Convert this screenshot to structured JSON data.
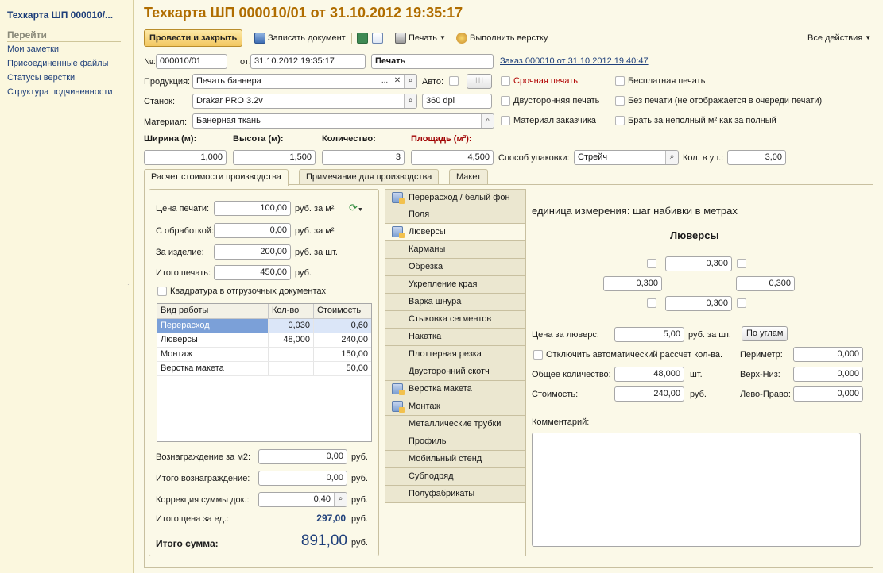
{
  "sidebar": {
    "title": "Техкарта ШП 000010/...",
    "goto_label": "Перейти",
    "links": [
      "Мои заметки",
      "Присоединенные файлы",
      "Статусы верстки",
      "Структура подчиненности"
    ]
  },
  "header": {
    "title": "Техкарта ШП 000010/01 от 31.10.2012 19:35:17"
  },
  "toolbar": {
    "post_close": "Провести и закрыть",
    "save_doc": "Записать документ",
    "print": "Печать",
    "do_layout": "Выполнить верстку",
    "all_actions": "Все действия"
  },
  "fields": {
    "number_label": "№:",
    "number": "000010/01",
    "from_label": "от:",
    "date": "31.10.2012 19:35:17",
    "status": "Печать",
    "order_link": "Заказ 000010 от 31.10.2012 19:40:47",
    "product_label": "Продукция:",
    "product": "Печать баннера",
    "auto_label": "Авто:",
    "machine_label": "Станок:",
    "machine": "Drakar PRO 3.2v",
    "dpi": "360 dpi",
    "material_label": "Материал:",
    "material": "Банерная ткань",
    "width_label": "Ширина (м):",
    "height_label": "Высота (м):",
    "qty_label": "Количество:",
    "area_label": "Площадь (м²):",
    "width": "1,000",
    "height": "1,500",
    "qty": "3",
    "area": "4,500",
    "pack_label": "Способ упаковки:",
    "pack": "Стрейч",
    "per_pack_label": "Кол. в уп.:",
    "per_pack": "3,00"
  },
  "flags": {
    "urgent": "Срочная печать",
    "free": "Бесплатная печать",
    "duplex": "Двусторонняя печать",
    "no_print": "Без печати (не отображается в очереди печати)",
    "customer_material": "Материал заказчика",
    "partial_m2": "Брать за неполный м² как за полный"
  },
  "tabs": [
    "Расчет стоимости производства",
    "Примечание для производства",
    "Макет"
  ],
  "cost": {
    "print_price_label": "Цена печати:",
    "print_price": "100,00",
    "print_price_unit": "руб. за  м²",
    "processing_label": "С обработкой:",
    "processing": "0,00",
    "processing_unit": "руб. за  м²",
    "per_item_label": "За изделие:",
    "per_item": "200,00",
    "per_item_unit": "руб. за  шт.",
    "total_print_label": "Итого печать:",
    "total_print": "450,00",
    "total_print_unit": "руб.",
    "quadrature_label": "Квадратура в отгрузочных документах",
    "works_headers": [
      "Вид работы",
      "Кол-во",
      "Стоимость"
    ],
    "works": [
      {
        "name": "Перерасход",
        "qty": "0,030",
        "cost": "0,60"
      },
      {
        "name": "Люверсы",
        "qty": "48,000",
        "cost": "240,00"
      },
      {
        "name": "Монтаж",
        "qty": "",
        "cost": "150,00"
      },
      {
        "name": "Верстка макета",
        "qty": "",
        "cost": "50,00"
      }
    ],
    "reward_m2_label": "Вознаграждение за м2:",
    "reward_m2": "0,00",
    "total_reward_label": "Итого вознаграждение:",
    "total_reward": "0,00",
    "correction_label": "Коррекция суммы док.:",
    "correction": "0,40",
    "unit_price_label": "Итого цена за ед.:",
    "unit_price": "297,00",
    "total_sum_label": "Итого сумма:",
    "total_sum": "891,00",
    "rub": "руб."
  },
  "services": [
    {
      "label": "Перерасход / белый фон",
      "icon": true
    },
    {
      "label": "Поля",
      "icon": false
    },
    {
      "label": "Люверсы",
      "icon": true,
      "active": true
    },
    {
      "label": "Карманы",
      "icon": false
    },
    {
      "label": "Обрезка",
      "icon": false
    },
    {
      "label": "Укрепление края",
      "icon": false
    },
    {
      "label": "Варка шнура",
      "icon": false
    },
    {
      "label": "Стыковка сегментов",
      "icon": false
    },
    {
      "label": "Накатка",
      "icon": false
    },
    {
      "label": "Плоттерная резка",
      "icon": false
    },
    {
      "label": "Двусторонний скотч",
      "icon": false
    },
    {
      "label": "Верстка макета",
      "icon": true
    },
    {
      "label": "Монтаж",
      "icon": true
    },
    {
      "label": "Металлические трубки",
      "icon": false
    },
    {
      "label": "Профиль",
      "icon": false
    },
    {
      "label": "Мобильный стенд",
      "icon": false
    },
    {
      "label": "Субподряд",
      "icon": false
    },
    {
      "label": "Полуфабрикаты",
      "icon": false
    }
  ],
  "grommets": {
    "unit_note": "единица измерения: шаг набивки в метрах",
    "heading": "Люверсы",
    "top": "0,300",
    "left": "0,300",
    "right": "0,300",
    "bottom": "0,300",
    "price_label": "Цена за люверс:",
    "price": "5,00",
    "price_unit": "руб. за шт.",
    "corners_btn": "По углам",
    "auto_off_label": "Отключить автоматический рассчет кол-ва.",
    "perimeter_label": "Периметр:",
    "perimeter": "0,000",
    "total_qty_label": "Общее количество:",
    "total_qty": "48,000",
    "total_qty_unit": "шт.",
    "top_bottom_label": "Верх-Низ:",
    "top_bottom": "0,000",
    "cost_label": "Стоимость:",
    "cost": "240,00",
    "cost_unit": "руб.",
    "left_right_label": "Лево-Право:",
    "left_right": "0,000",
    "comment_label": "Комментарий:"
  },
  "colors": {
    "title": "#b06d00",
    "link": "#1e3f7a",
    "urgent": "#b00000",
    "area_label": "#a00000",
    "total_blue": "#1e3f7a"
  }
}
